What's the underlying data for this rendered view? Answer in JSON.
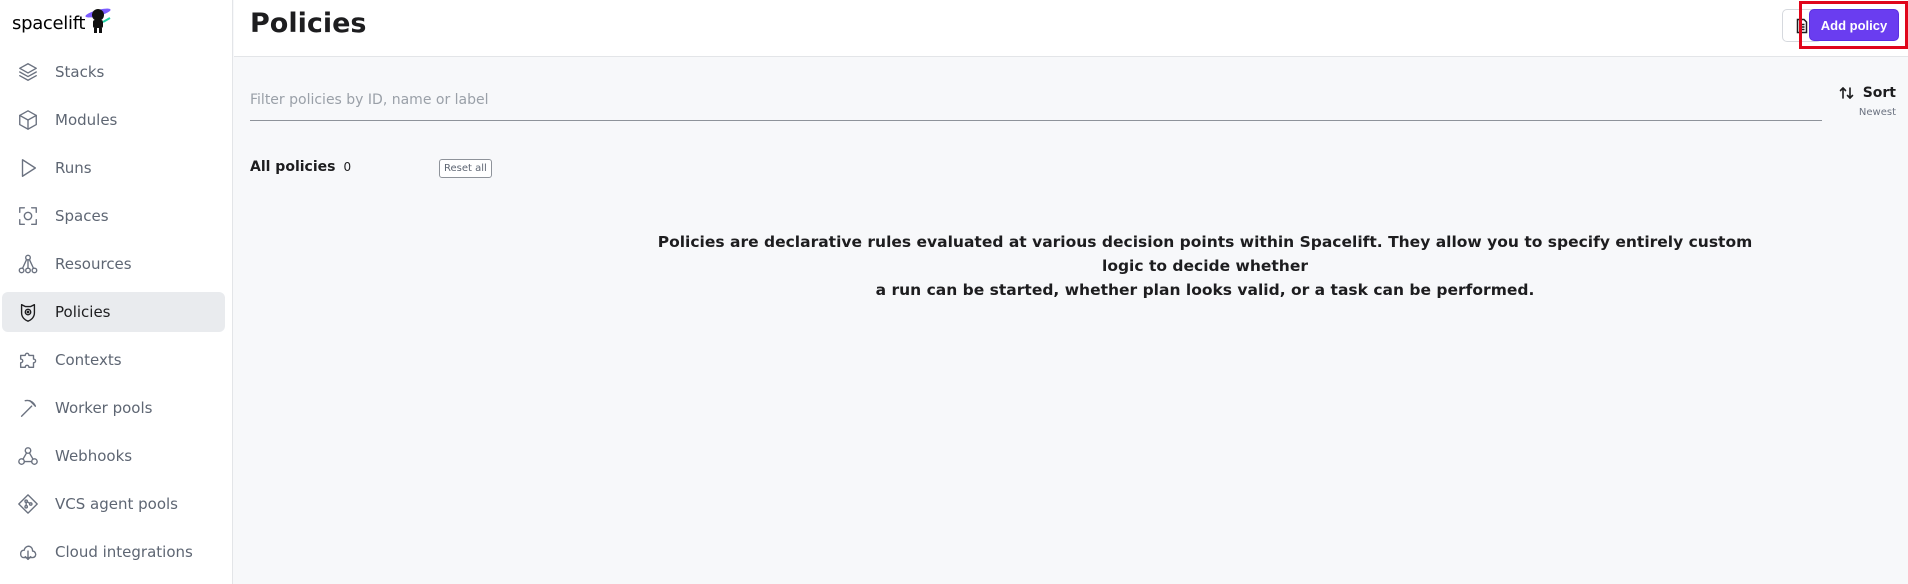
{
  "brand": {
    "name": "spacelift",
    "accent": "#6a3df0"
  },
  "sidebar": {
    "items": [
      {
        "label": "Stacks",
        "icon": "layers-icon",
        "active": false
      },
      {
        "label": "Modules",
        "icon": "cube-icon",
        "active": false
      },
      {
        "label": "Runs",
        "icon": "play-icon",
        "active": false
      },
      {
        "label": "Spaces",
        "icon": "spaces-icon",
        "active": false
      },
      {
        "label": "Resources",
        "icon": "resources-icon",
        "active": false
      },
      {
        "label": "Policies",
        "icon": "policies-icon",
        "active": true
      },
      {
        "label": "Contexts",
        "icon": "puzzle-icon",
        "active": false
      },
      {
        "label": "Worker pools",
        "icon": "pickaxe-icon",
        "active": false
      },
      {
        "label": "Webhooks",
        "icon": "webhook-icon",
        "active": false
      },
      {
        "label": "VCS agent pools",
        "icon": "vcs-icon",
        "active": false
      },
      {
        "label": "Cloud integrations",
        "icon": "cloud-icon",
        "active": false
      }
    ]
  },
  "header": {
    "title": "Policies",
    "doc_icon": "document-icon",
    "add_label": "Add policy"
  },
  "filter": {
    "placeholder": "Filter policies by ID, name or label",
    "value": ""
  },
  "sort": {
    "label": "Sort",
    "value": "Newest",
    "icon": "sort-arrows-icon"
  },
  "list": {
    "title": "All policies",
    "count": "0",
    "reset_label": "Reset all"
  },
  "empty_state": {
    "line1": "Policies are declarative rules evaluated at various decision points within Spacelift. They allow you to specify entirely custom logic to decide whether",
    "line2": "a run can be started, whether plan looks valid, or a task can be performed."
  }
}
